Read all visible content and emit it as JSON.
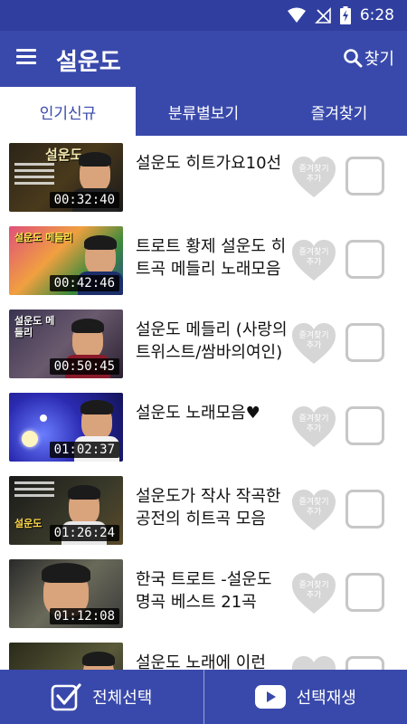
{
  "status_bar": {
    "time": "6:28",
    "icons": [
      "wifi-icon",
      "no-signal-icon",
      "battery-charging-icon"
    ]
  },
  "app_bar": {
    "title": "설운도",
    "search_label": "찾기"
  },
  "tabs": [
    {
      "label": "인기신규",
      "active": true
    },
    {
      "label": "분류별보기",
      "active": false
    },
    {
      "label": "즐겨찾기",
      "active": false
    }
  ],
  "favorite_label": "즐겨찾기\n추가",
  "videos": [
    {
      "title": "설운도 히트가요10선",
      "duration": "00:32:40",
      "thumb_text": "설운도"
    },
    {
      "title": "트로트 황제 설운도 히트곡 메들리 노래모음",
      "duration": "00:42:46",
      "thumb_text": "설운도 메들리"
    },
    {
      "title": "설운도 메들리 (사랑의트위스트/쌈바의여인)",
      "duration": "00:50:45",
      "thumb_text": "설운도 메들리"
    },
    {
      "title": "설운도 노래모음♥",
      "duration": "01:02:37",
      "thumb_text": ""
    },
    {
      "title": "설운도가 작사 작곡한 공전의 히트곡 모음",
      "duration": "01:26:24",
      "thumb_text": "설운도"
    },
    {
      "title": "한국 트로트 -설운도 명곡 베스트 21곡",
      "duration": "01:12:08",
      "thumb_text": ""
    },
    {
      "title": "설운도 노래에 이런",
      "duration": "",
      "thumb_text": ""
    }
  ],
  "bottom_bar": {
    "select_all_label": "전체선택",
    "play_selected_label": "선택재생"
  },
  "colors": {
    "primary": "#3949ab",
    "status": "#303f9f",
    "heart": "#d6d6d6",
    "checkbox_border": "#c7c7c7"
  }
}
